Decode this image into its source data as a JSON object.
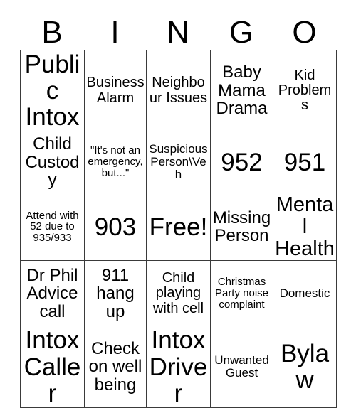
{
  "card": {
    "title": "BINGO",
    "header_letters": [
      "B",
      "I",
      "N",
      "G",
      "O"
    ],
    "free_space_label": "Free!",
    "columns": 5,
    "rows": 5,
    "border_color": "#3a3a3a",
    "background_color": "#ffffff",
    "text_color": "#000000",
    "cells": [
      [
        {
          "text": "Public Intox",
          "size": "s-xxl"
        },
        {
          "text": "Business Alarm",
          "size": "s-md"
        },
        {
          "text": "Neighbour Issues",
          "size": "s-md"
        },
        {
          "text": "Baby Mama Drama",
          "size": "s-lg"
        },
        {
          "text": "Kid Problems",
          "size": "s-md"
        }
      ],
      [
        {
          "text": "Child Custody",
          "size": "s-lg"
        },
        {
          "text": "\"It's not an emergency, but...\"",
          "size": "s-xs"
        },
        {
          "text": "Suspicious Person\\Veh",
          "size": "s-sm"
        },
        {
          "text": "952",
          "size": "s-xxl"
        },
        {
          "text": "951",
          "size": "s-xxl"
        }
      ],
      [
        {
          "text": "Attend with 52 due to 935/933",
          "size": "s-xs"
        },
        {
          "text": "903",
          "size": "s-xxl"
        },
        {
          "text": "Free!",
          "size": "s-xxl",
          "free": true
        },
        {
          "text": "Missing Person",
          "size": "s-lg"
        },
        {
          "text": "Mental Health",
          "size": "s-xl"
        }
      ],
      [
        {
          "text": "Dr Phil Advice call",
          "size": "s-lg"
        },
        {
          "text": "911 hang up",
          "size": "s-lg"
        },
        {
          "text": "Child playing with cell",
          "size": "s-md"
        },
        {
          "text": "Christmas Party noise complaint",
          "size": "s-xs"
        },
        {
          "text": "Domestic",
          "size": "s-sm"
        }
      ],
      [
        {
          "text": "Intox Caller",
          "size": "s-xxl"
        },
        {
          "text": "Check on well being",
          "size": "s-lg"
        },
        {
          "text": "Intox Driver",
          "size": "s-xxl"
        },
        {
          "text": "Unwanted Guest",
          "size": "s-sm"
        },
        {
          "text": "Bylaw",
          "size": "s-xxl"
        }
      ]
    ]
  }
}
